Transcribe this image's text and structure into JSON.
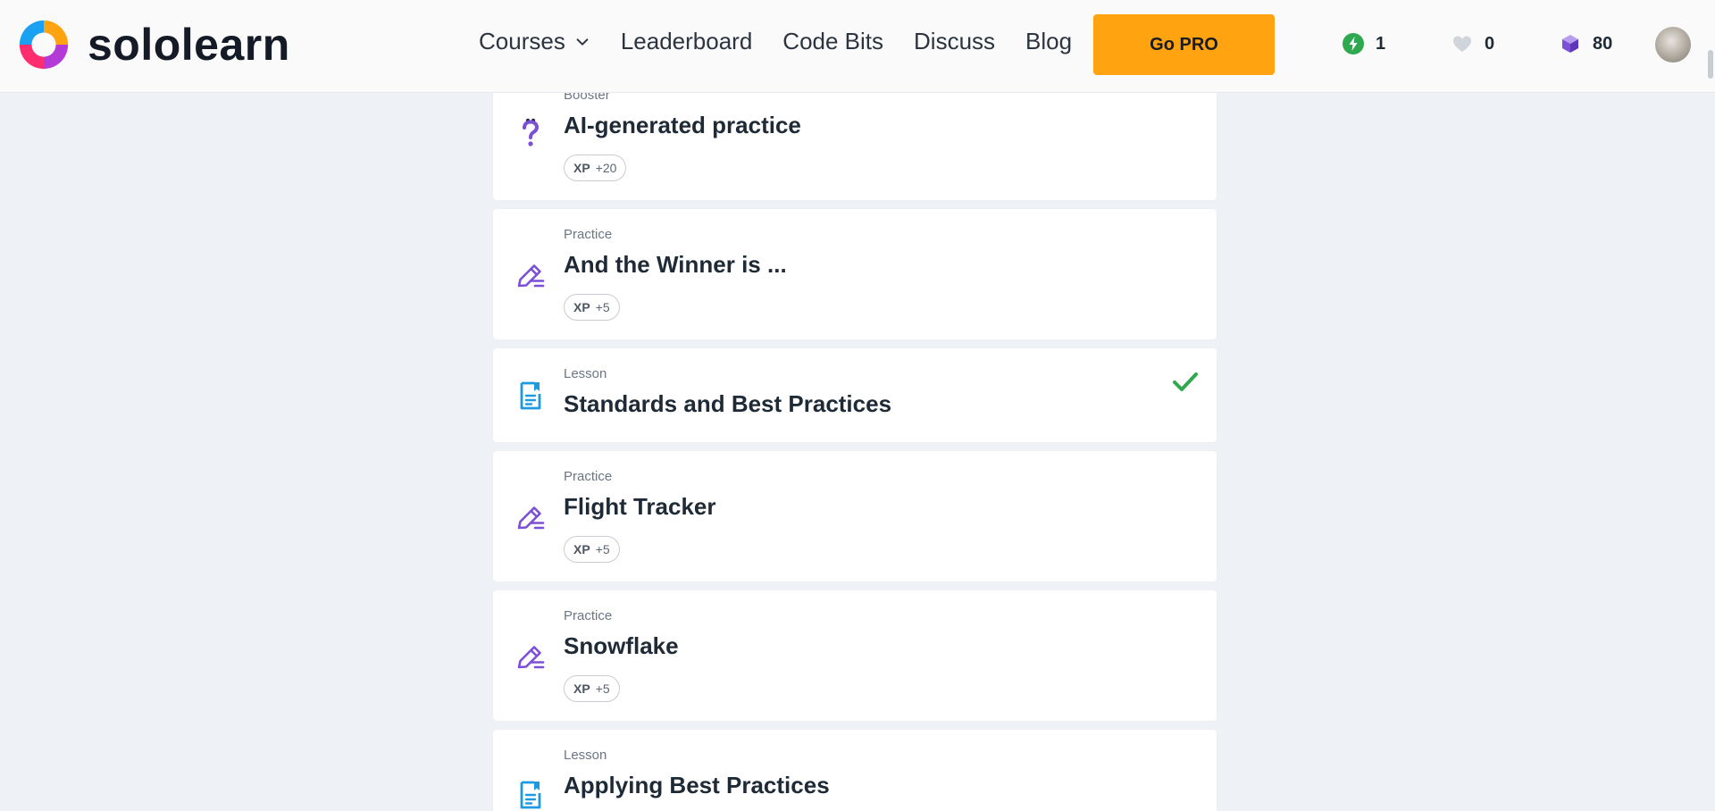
{
  "header": {
    "brand": "sololearn",
    "nav": {
      "courses": "Courses",
      "leaderboard": "Leaderboard",
      "code_bits": "Code Bits",
      "discuss": "Discuss",
      "blog": "Blog"
    },
    "go_pro": "Go PRO",
    "stats": {
      "streak": "1",
      "hearts": "0",
      "bits": "80"
    }
  },
  "cards": [
    {
      "type": "Booster",
      "title": "AI-generated practice",
      "xp_label": "XP",
      "xp_value": "+20",
      "icon": "question-mark-icon"
    },
    {
      "type": "Practice",
      "title": "And the Winner is ...",
      "xp_label": "XP",
      "xp_value": "+5",
      "icon": "pencil-icon"
    },
    {
      "type": "Lesson",
      "title": "Standards and Best Practices",
      "icon": "lesson-doc-icon",
      "completed": true
    },
    {
      "type": "Practice",
      "title": "Flight Tracker",
      "xp_label": "XP",
      "xp_value": "+5",
      "icon": "pencil-icon"
    },
    {
      "type": "Practice",
      "title": "Snowflake",
      "xp_label": "XP",
      "xp_value": "+5",
      "icon": "pencil-icon"
    },
    {
      "type": "Lesson",
      "title": "Applying Best Practices",
      "icon": "lesson-doc-icon"
    }
  ],
  "colors": {
    "accent_purple": "#7b4fd6",
    "lesson_blue": "#1e9be0",
    "go_pro_orange": "#ffa310",
    "check_green": "#2fa84f"
  }
}
